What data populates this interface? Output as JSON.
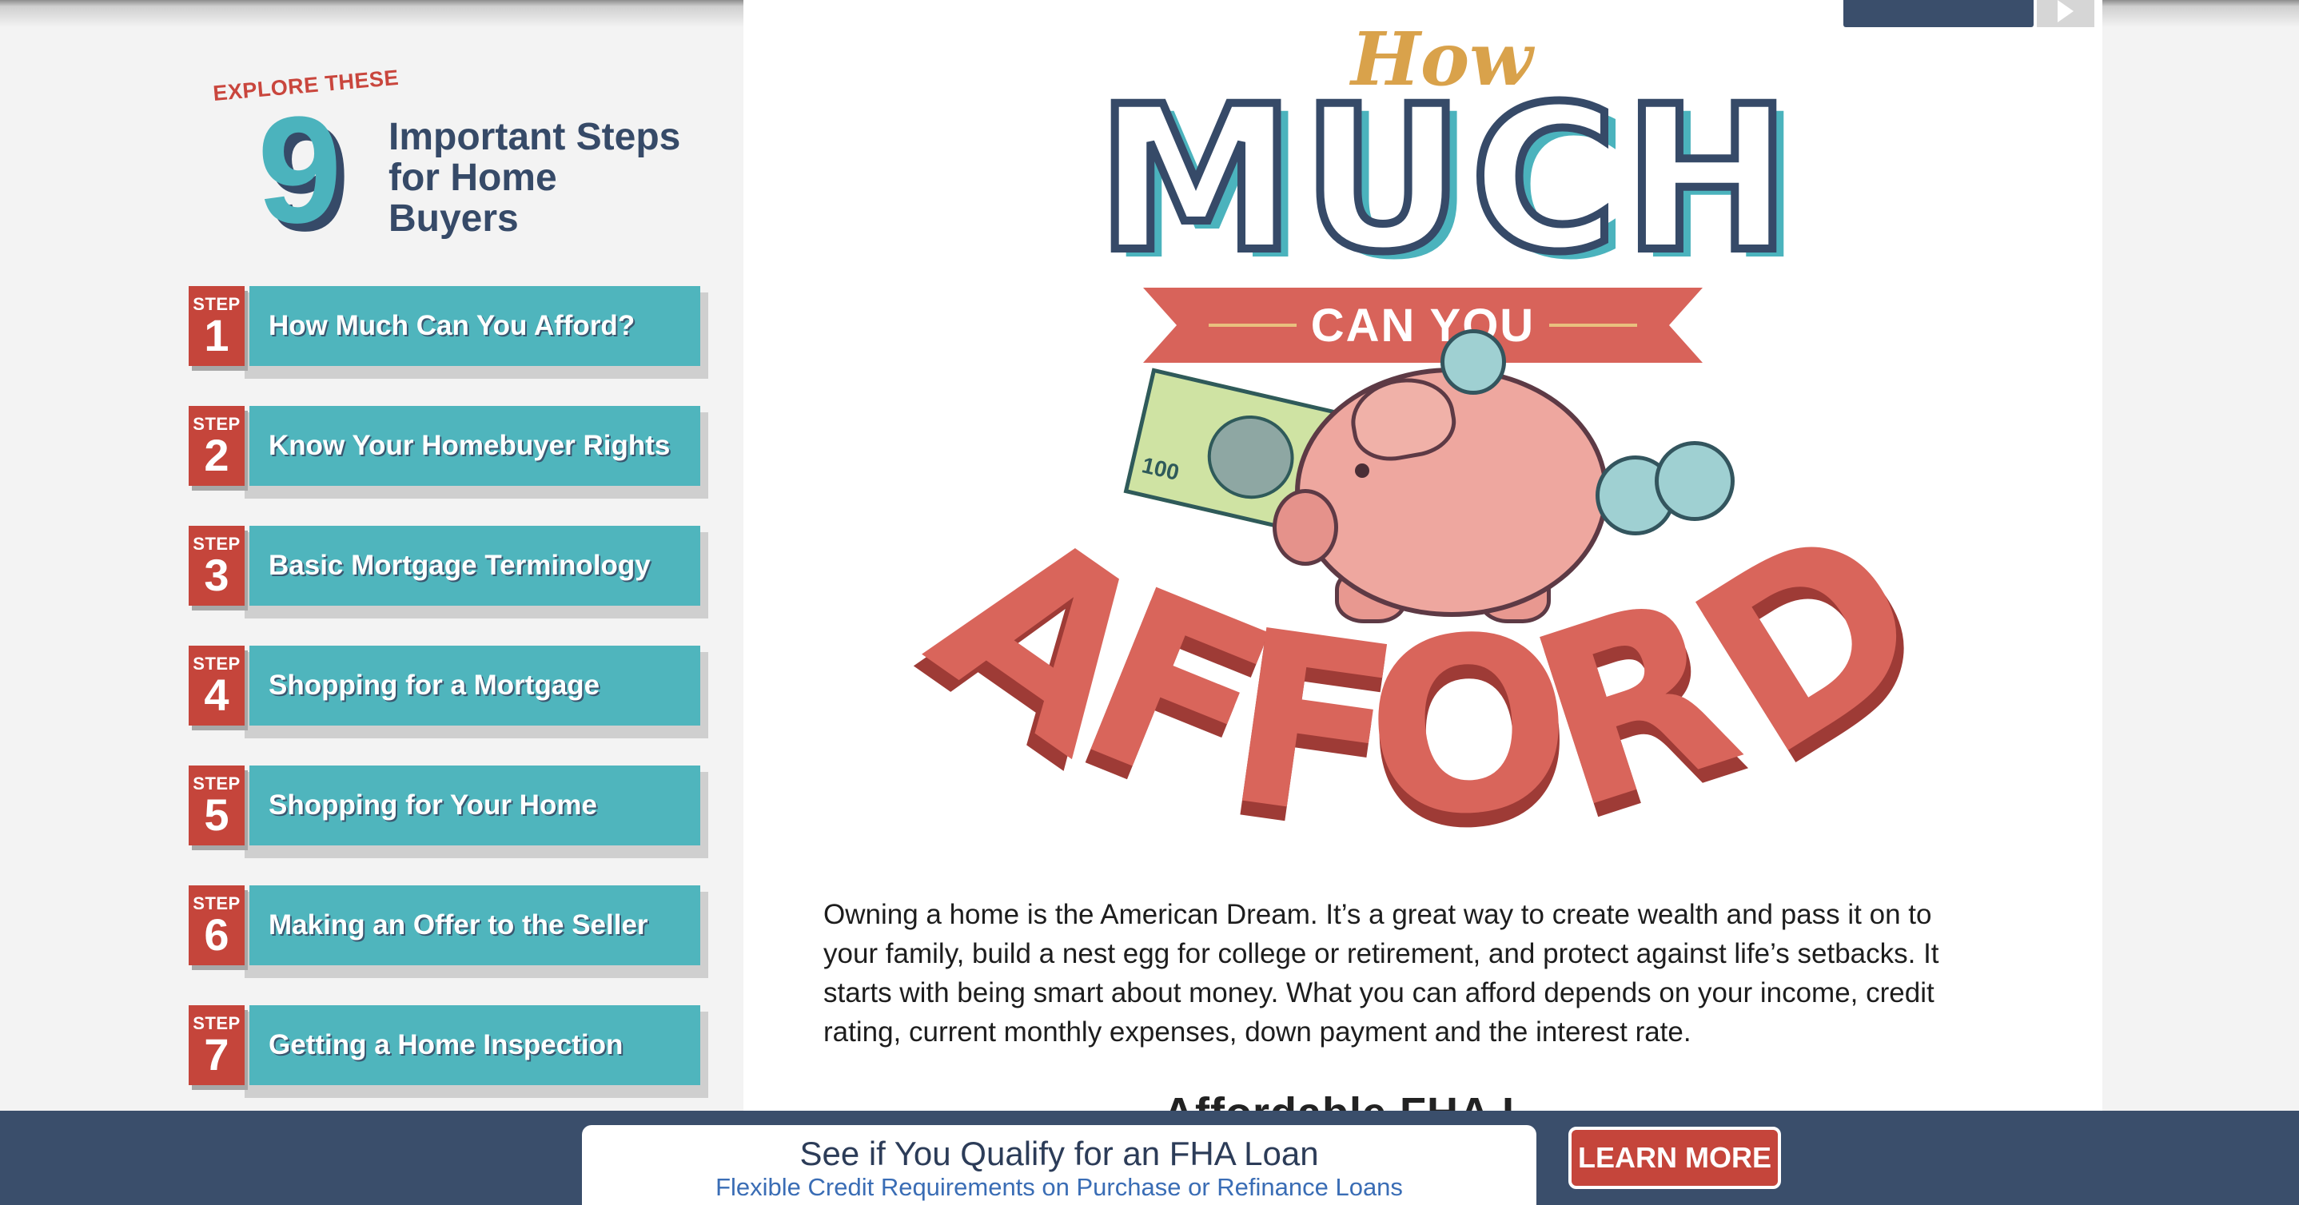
{
  "sidebar": {
    "explore_label": "EXPLORE THESE",
    "big_number": "9",
    "title": "Important Steps for Home Buyers",
    "step_word": "STEP",
    "steps": [
      {
        "num": "1",
        "label": "How Much Can You Afford?"
      },
      {
        "num": "2",
        "label": "Know Your Homebuyer Rights"
      },
      {
        "num": "3",
        "label": "Basic Mortgage Terminology"
      },
      {
        "num": "4",
        "label": "Shopping for a Mortgage"
      },
      {
        "num": "5",
        "label": "Shopping for Your Home"
      },
      {
        "num": "6",
        "label": "Making an Offer to the Seller"
      },
      {
        "num": "7",
        "label": "Getting a Home Inspection"
      }
    ]
  },
  "hero": {
    "how": "How",
    "much": "MUCH",
    "can_you": "CAN YOU",
    "afford": "AFFORD",
    "bill_value": "100"
  },
  "content": {
    "intro": "Owning a home is the American Dream. It’s a great way to create wealth and pass it on to your family, build a nest egg for college or retirement, and protect against life’s setbacks. It starts with being smart about money. What you can afford depends on your income, credit rating, current monthly expenses, down payment and the interest rate.",
    "next_heading_peek": "Affordable FHA L"
  },
  "ad": {
    "title": "See if You Qualify for an FHA Loan",
    "subtitle": "Flexible Credit Requirements on Purchase or Refinance Loans",
    "button": "LEARN MORE"
  },
  "colors": {
    "teal": "#4fb5bd",
    "navy": "#364a68",
    "red": "#c5453b",
    "coral": "#d9655b",
    "gold": "#d9a24b"
  },
  "icons": {
    "top_nav_next": "chevron-right-icon"
  }
}
